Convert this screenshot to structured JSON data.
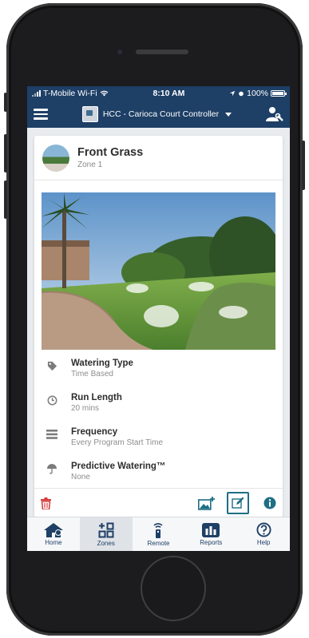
{
  "status_bar": {
    "carrier": "T-Mobile Wi-Fi",
    "time": "8:10 AM",
    "battery": "100%"
  },
  "nav": {
    "controller_name": "HCC - Carioca Court Controller"
  },
  "zone": {
    "name": "Front Grass",
    "subtitle": "Zone 1"
  },
  "details": [
    {
      "label": "Watering Type",
      "value": "Time Based",
      "icon": "tag-icon"
    },
    {
      "label": "Run Length",
      "value": "20 mins",
      "icon": "clock-icon"
    },
    {
      "label": "Frequency",
      "value": "Every Program Start Time",
      "icon": "list-icon"
    },
    {
      "label": "Predictive Watering™",
      "value": "None",
      "icon": "umbrella-icon"
    }
  ],
  "tabs": [
    {
      "label": "Home",
      "icon": "home-icon"
    },
    {
      "label": "Zones",
      "icon": "zones-grid-icon",
      "active": true
    },
    {
      "label": "Remote",
      "icon": "remote-icon"
    },
    {
      "label": "Reports",
      "icon": "reports-icon"
    },
    {
      "label": "Help",
      "icon": "help-icon"
    }
  ],
  "colors": {
    "brand": "#1e3f66",
    "delete": "#d9383a",
    "accent": "#1e6e84"
  }
}
